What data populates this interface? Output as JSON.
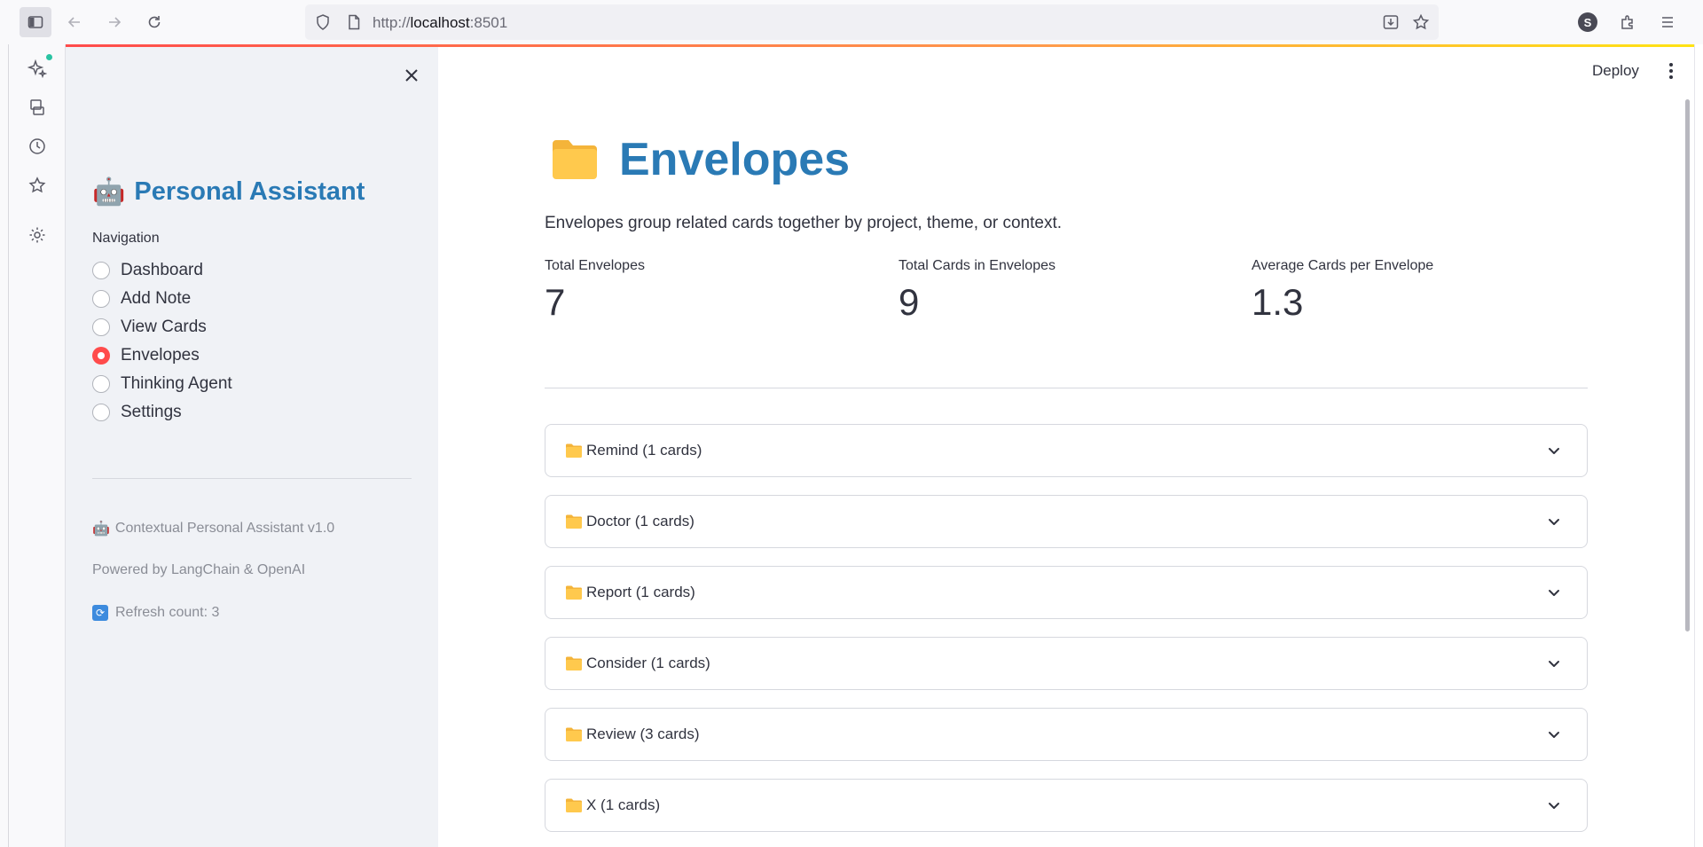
{
  "browser": {
    "url_protocol": "http://",
    "url_host": "localhost",
    "url_port": ":8501",
    "profile_initial": "S"
  },
  "sidebar": {
    "brand_emoji": "🤖",
    "brand_title": "Personal Assistant",
    "nav_label": "Navigation",
    "nav_items": [
      {
        "label": "Dashboard",
        "selected": false
      },
      {
        "label": "Add Note",
        "selected": false
      },
      {
        "label": "View Cards",
        "selected": false
      },
      {
        "label": "Envelopes",
        "selected": true
      },
      {
        "label": "Thinking Agent",
        "selected": false
      },
      {
        "label": "Settings",
        "selected": false
      }
    ],
    "footer_version": "Contextual Personal Assistant v1.0",
    "footer_powered": "Powered by LangChain & OpenAI",
    "footer_refresh": "Refresh count: 3"
  },
  "header": {
    "deploy_label": "Deploy"
  },
  "main": {
    "title": "Envelopes",
    "description": "Envelopes group related cards together by project, theme, or context.",
    "metrics": [
      {
        "label": "Total Envelopes",
        "value": "7"
      },
      {
        "label": "Total Cards in Envelopes",
        "value": "9"
      },
      {
        "label": "Average Cards per Envelope",
        "value": "1.3"
      }
    ],
    "envelopes": [
      {
        "label": "Remind (1 cards)"
      },
      {
        "label": "Doctor (1 cards)"
      },
      {
        "label": "Report (1 cards)"
      },
      {
        "label": "Consider (1 cards)"
      },
      {
        "label": "Review (3 cards)"
      },
      {
        "label": "X (1 cards)"
      }
    ]
  },
  "colors": {
    "accent": "#ff4b4b",
    "title_blue": "#2a7ab5",
    "sidebar_bg": "#f0f2f6"
  }
}
